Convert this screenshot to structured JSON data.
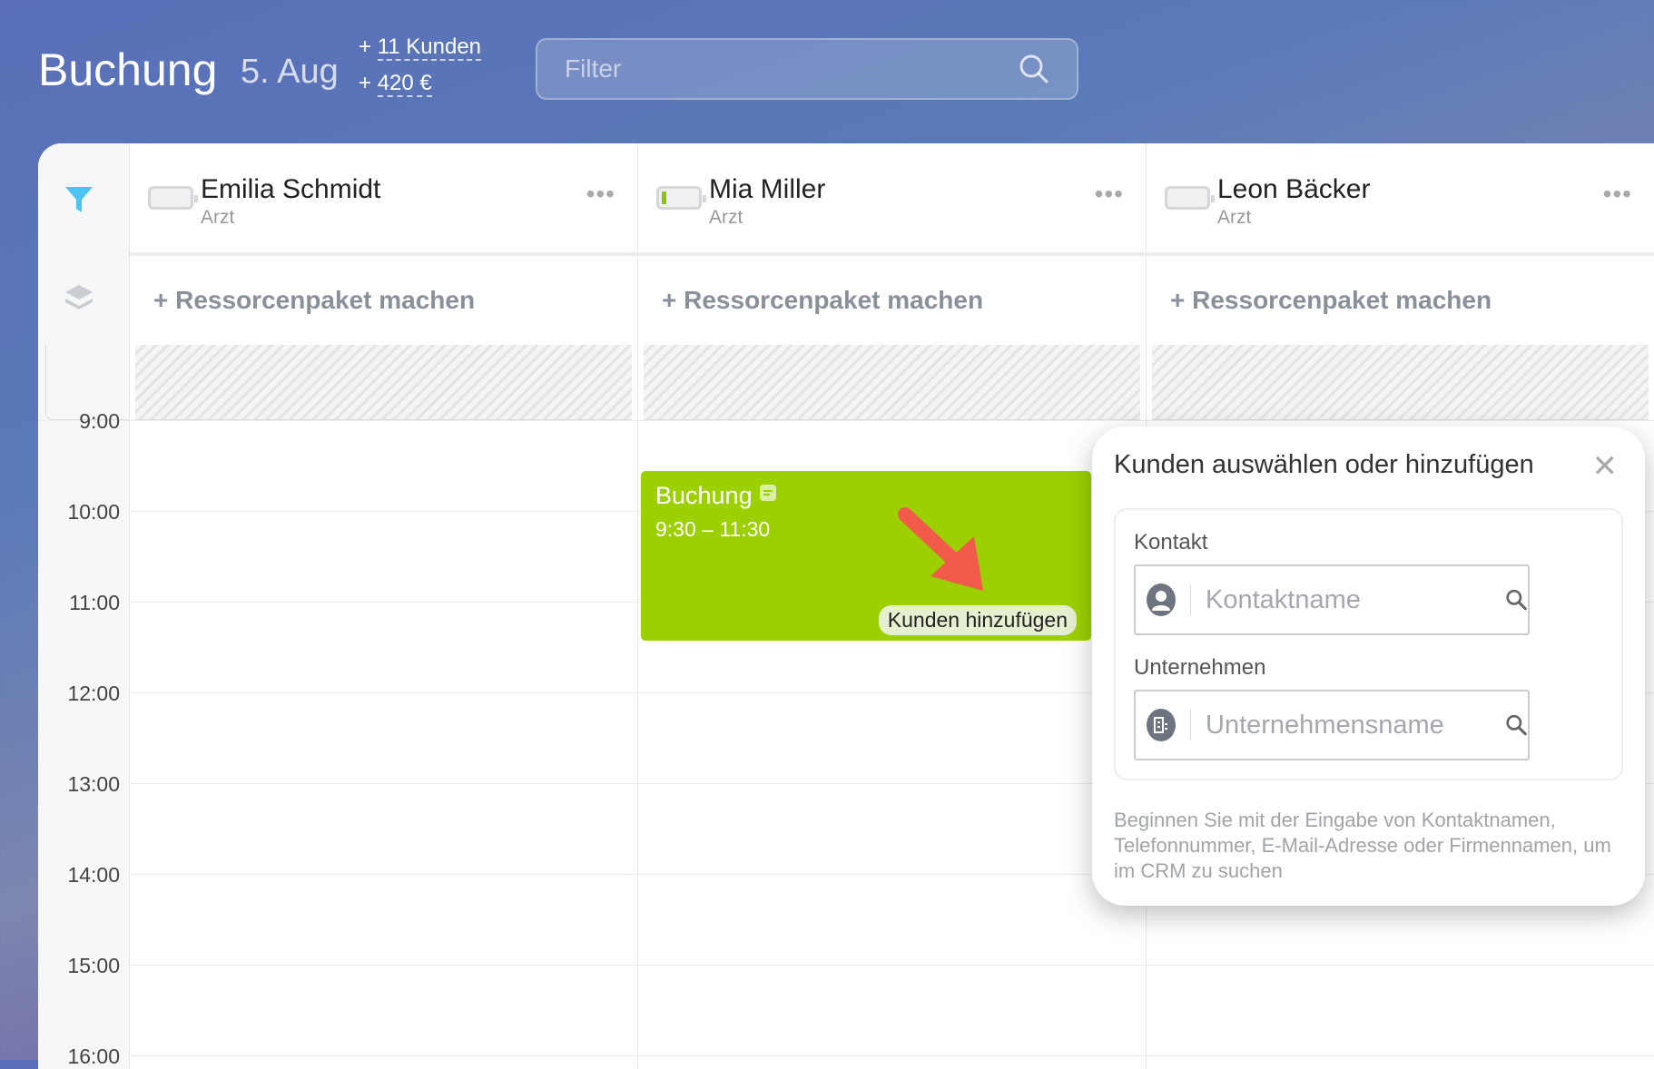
{
  "header": {
    "title": "Buchung",
    "date": "5. Aug",
    "stat_clients": "+ 11 Kunden",
    "stat_clients_prefix": "+ ",
    "stat_clients_value": "11 Kunden",
    "stat_amount_prefix": "+ ",
    "stat_amount_value": "420 €",
    "filter_placeholder": "Filter"
  },
  "resources": [
    {
      "name": "Emilia Schmidt",
      "role": "Arzt",
      "battery": "empty"
    },
    {
      "name": "Mia Miller",
      "role": "Arzt",
      "battery": "low"
    },
    {
      "name": "Leon Bäcker",
      "role": "Arzt",
      "battery": "empty"
    }
  ],
  "package_label": "Ressorcenpaket machen",
  "times": [
    "9:00",
    "10:00",
    "11:00",
    "12:00",
    "13:00",
    "14:00",
    "15:00",
    "16:00"
  ],
  "booking": {
    "title": "Buchung",
    "time": "9:30 – 11:30",
    "add_client": "Kunden hinzufügen",
    "color": "#9dd000"
  },
  "popup": {
    "title": "Kunden auswählen oder hinzufügen",
    "contact_label": "Kontakt",
    "contact_placeholder": "Kontaktname",
    "company_label": "Unternehmen",
    "company_placeholder": "Unternehmensname",
    "help": "Beginnen Sie mit der Eingabe von Kontaktnamen, Telefonnummer, E-Mail-Adresse oder Firmennamen, um im CRM zu suchen"
  },
  "colors": {
    "accent": "#9dd000",
    "arrow": "#f25a4a",
    "filter_icon": "#4cc3f0"
  }
}
